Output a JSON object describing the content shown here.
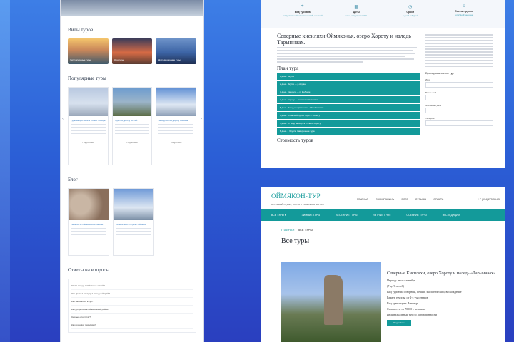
{
  "left": {
    "hero_links": [
      "",
      "",
      "",
      ""
    ],
    "sections": {
      "tour_types": "Виды туров",
      "popular": "Популярные туры",
      "blog": "Блог",
      "faq": "Ответы на вопросы"
    },
    "tour_types": [
      {
        "caption": "Экскурсионные туры"
      },
      {
        "caption": "Этнотуры"
      },
      {
        "caption": "Экспедиционные туры"
      }
    ],
    "popular": [
      {
        "link": "Туры на фестиваль Полюс Холода",
        "button": "Подробнее"
      },
      {
        "link": "Туры на Дорогу костей",
        "button": "Подробнее"
      },
      {
        "link": "Экскурсия на Дорогу Колыма",
        "button": "Подробнее"
      }
    ],
    "blog": [
      {
        "link": "Рыбалка в Оймяконском районе"
      },
      {
        "link": "Пересечения по реке Оймякон"
      }
    ],
    "faq": [
      "Какая погода в Оймяконе зимой?",
      "Что брать в поездку в холодный край?",
      "Как записаться в тур?",
      "Как добраться в Оймяконский район?",
      "Сколько стоит тур?",
      "Как проходят экскурсии?"
    ]
  },
  "right_top": {
    "stats": [
      {
        "icon": "map-icon",
        "label": "Вид туризма",
        "value": "экскурсионный, экологический, осенний"
      },
      {
        "icon": "calendar-icon",
        "label": "Даты",
        "value": "июнь, август, сентябрь"
      },
      {
        "icon": "clock-icon",
        "label": "Сроки",
        "value": "5 дней и 7 дней"
      },
      {
        "icon": "group-icon",
        "label": "Состав группы",
        "value": "от 2 до 9 человек"
      }
    ],
    "title": "Северные кисиляхи Оймяконья, озеро Хороту и наледь Тарыннаах.",
    "plan_title": "План тура",
    "plan": [
      "1 день. Якутск",
      "2 день. Якутск — р.Алдан",
      "3 день. Хандыга — п. Кюбюме",
      "4 день. Хороту — Северные Кисиляхи",
      "5 день. Поход на кряжи горы «Пик-Кисилях»",
      "6 день. Обратный путь с горы — Хороту",
      "7 день. Отъезд на Якутск и озеро Хороту",
      "8 день. г. Якутск, Завершение тура"
    ],
    "cost_title": "Стоимость туров",
    "side_booking": "Бронирование на тур",
    "side_fields": [
      "Имя",
      "Ваш e-mail",
      "Желаемая дата",
      "Телефон"
    ]
  },
  "right_bottom": {
    "logo": "ОЙМЯКОН-ТУР",
    "tagline": "АКТИВНЫЙ ОТДЫХ, ОХОТА И РЫБАЛКА В ЯКУТИИ",
    "nav": [
      "ГЛАВНАЯ",
      "О КОМПАНИИ ▾",
      "БЛОГ",
      "ОТЗЫВЫ",
      "ОПЛАТА"
    ],
    "phone": "+7 (914) 275-56-25",
    "menu": [
      "ВСЕ ТУРЫ ▾",
      "ЗИМНИЕ ТУРЫ",
      "ВЕСЕННИЕ ТУРЫ",
      "ЛЕТНИЕ ТУРЫ",
      "ОСЕННИЕ ТУРЫ",
      "ЭКСПЕДИЦИИ"
    ],
    "breadcrumb_home": "ГЛАВНАЯ",
    "breadcrumb_current": "ВСЕ ТУРЫ",
    "page_title": "Все туры",
    "card": {
      "title": "Северные Кисиляхи, озеро Хороту и наледь «Тарыннаах»",
      "lines": [
        "Период: июль-сентябрь",
        "(7 дн/6 ночей)",
        "Вид туризма: обзорный, пеший, экологический, восхождение",
        "Размер группы: от 2-х участников",
        "Вид транспорта: Автотур",
        "Стоимость: от 70000 с человека",
        "Индивидуальный тур по договоренности"
      ],
      "button": "Подробнее"
    }
  },
  "colors": {
    "accent": "#139a9a",
    "link": "#3b7fc4",
    "bg_top": "#3d7ee6",
    "bg_bottom": "#2a3fbf"
  }
}
